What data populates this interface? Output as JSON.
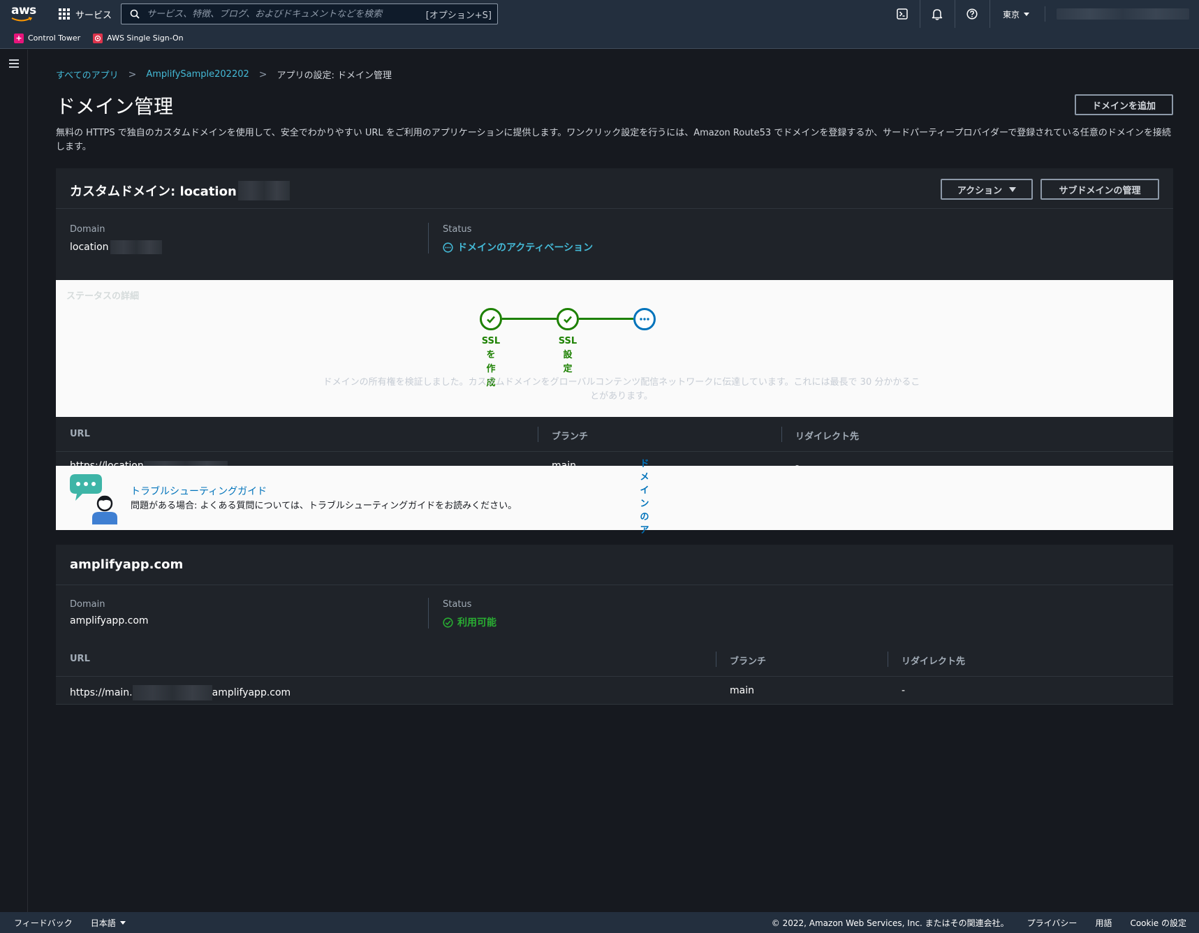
{
  "topnav": {
    "logo": "aws",
    "services_label": "サービス",
    "search_placeholder": "サービス、特徴、ブログ、およびドキュメントなどを検索",
    "search_shortcut": "[オプション+S]",
    "region": "東京",
    "icons": [
      "cloudshell-icon",
      "bell-icon",
      "help-icon"
    ]
  },
  "favorites": [
    {
      "label": "Control Tower",
      "icon": "control-tower-icon",
      "color": "#e7157b"
    },
    {
      "label": "AWS Single Sign-On",
      "icon": "sso-icon",
      "color": "#dd344c"
    }
  ],
  "breadcrumb": {
    "root": "すべてのアプリ",
    "app": "AmplifySample202202",
    "current": "アプリの設定: ドメイン管理"
  },
  "page": {
    "title": "ドメイン管理",
    "add_domain_button": "ドメインを追加",
    "description": "無料の HTTPS で独自のカスタムドメインを使用して、安全でわかりやすい URL をご利用のアプリケーションに提供します。ワンクリック設定を行うには、Amazon Route53 でドメインを登録するか、サードパーティープロバイダーで登録されている任意のドメインを接続します。"
  },
  "custom_domain": {
    "title": "カスタムドメイン: location",
    "actions_button": "アクション",
    "subdomain_button": "サブドメインの管理",
    "domain_label": "Domain",
    "domain_value": "location",
    "status_label": "Status",
    "status_value": "ドメインのアクティベーション",
    "status_detail_label": "ステータスの詳細",
    "steps": [
      {
        "label": "SSLを作成",
        "state": "done"
      },
      {
        "label": "SSL設定",
        "state": "done"
      },
      {
        "label": "ドメインのアクティベーション",
        "state": "active"
      }
    ],
    "status_message": "ドメインの所有権を検証しました。カスタムドメインをグローバルコンテンツ配信ネットワークに伝達しています。これには最長で 30 分かかることがあります。",
    "table": {
      "headers": [
        "URL",
        "ブランチ",
        "リダイレクト先"
      ],
      "rows": [
        [
          "https://location",
          "main",
          "-"
        ]
      ]
    },
    "troubleshooting": {
      "title": "トラブルシューティングガイド",
      "text": "問題がある場合: よくある質問については、トラブルシューティングガイドをお読みください。"
    }
  },
  "amplify_domain": {
    "title": "amplifyapp.com",
    "domain_label": "Domain",
    "domain_value": "amplifyapp.com",
    "status_label": "Status",
    "status_value": "利用可能",
    "table": {
      "headers": [
        "URL",
        "ブランチ",
        "リダイレクト先"
      ],
      "rows": [
        {
          "url_prefix": "https://main.",
          "url_suffix": "amplifyapp.com",
          "branch": "main",
          "redirect": "-"
        }
      ]
    }
  },
  "footer": {
    "feedback": "フィードバック",
    "language": "日本語",
    "copyright": "© 2022, Amazon Web Services, Inc. またはその関連会社。",
    "privacy": "プライバシー",
    "terms": "用語",
    "cookie": "Cookie の設定"
  },
  "colors": {
    "accent_link": "#44b9d6",
    "success": "#1d8102",
    "active_step": "#0073bb",
    "nav_bg": "#232f3e",
    "page_bg": "#16191f"
  }
}
